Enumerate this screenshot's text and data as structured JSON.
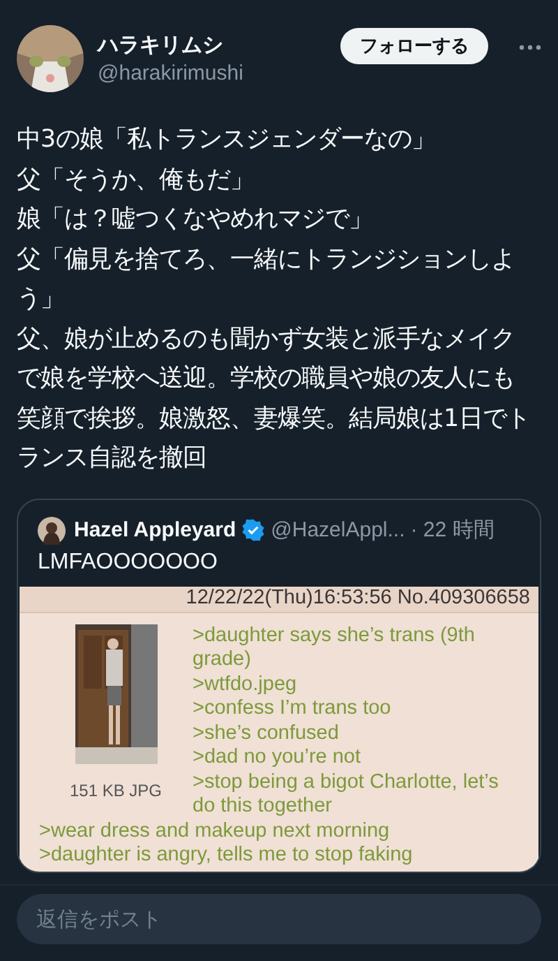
{
  "author": {
    "name": "ハラキリムシ",
    "handle": "@harakirimushi"
  },
  "follow_button": "フォローする",
  "tweet_lines": [
    "中3の娘「私トランスジェンダーなの」",
    "父「そうか、俺もだ」",
    "娘「は？嘘つくなやめれマジで」",
    "父「偏見を捨てろ、一緒にトランジションしよう」",
    "父、娘が止めるのも聞かず女装と派手なメイクで娘を学校へ送迎。学校の職員や娘の友人にも笑顔で挨拶。娘激怒、妻爆笑。結局娘は1日でトランス自認を撤回"
  ],
  "quote": {
    "name": "Hazel Appleyard",
    "verified": true,
    "handle": "@HazelAppl...",
    "time": "· 22 時間",
    "text": "LMFAOOOOOOO",
    "image": {
      "header": "12/22/22(Thu)16:53:56 No.409306658",
      "file_info": "151 KB JPG",
      "side_lines": [
        ">daughter says she’s trans (9th grade)",
        ">wtfdo.jpeg",
        ">confess I’m trans too",
        ">she’s confused",
        ">dad no you’re not",
        ">stop being a bigot Charlotte, let’s do this together"
      ],
      "full_lines": [
        ">wear dress and makeup next morning",
        ">daughter is angry, tells me to stop faking"
      ]
    }
  },
  "reply": {
    "placeholder": "返信をポスト"
  }
}
